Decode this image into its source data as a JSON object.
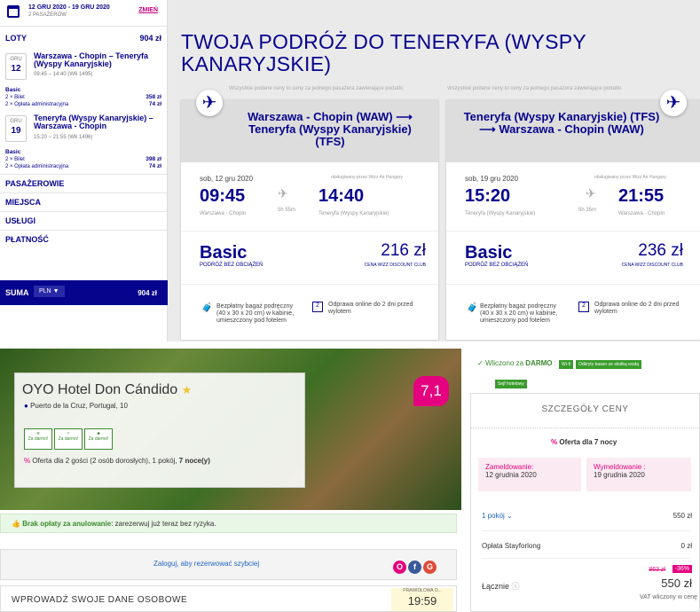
{
  "sidebar": {
    "dates": "12 GRU 2020 - 19 GRU 2020",
    "pax": "2 PASAŻERÓW",
    "change": "ZMIEŃ",
    "flights_label": "LOTY",
    "flights_total": "904 zł",
    "f1": {
      "month": "GRU",
      "day": "12",
      "route": "Warszawa - Chopin – Teneryfa (Wyspy Kanaryjskie)",
      "time": "09:45 – 14:40 (W6 1495)",
      "fare": "Basic",
      "l1": "2 × Bilet",
      "v1": "358 zł",
      "l2": "2 × Opłata administracyjna",
      "v2": "74 zł"
    },
    "f2": {
      "month": "GRU",
      "day": "19",
      "route": "Teneryfa (Wyspy Kanaryjskie) – Warszawa - Chopin",
      "time": "15:20 – 21:55 (W6 1496)",
      "fare": "Basic",
      "l1": "2 × Bilet",
      "v1": "398 zł",
      "l2": "2 × Opłata administracyjna",
      "v2": "74 zł"
    },
    "acc": [
      "PASAŻEROWIE",
      "MIEJSCA",
      "USŁUGI",
      "PŁATNOŚĆ"
    ],
    "suma": "SUMA",
    "currency": "PLN",
    "total": "904 zł"
  },
  "main": {
    "title": "TWOJA PODRÓŻ DO TENERYFA (WYSPY KANARYJSKIE)",
    "note": "Wszystkie podane ceny to ceny za jednego pasażera zawierające podatki.",
    "cards": [
      {
        "route": "Warszawa - Chopin (WAW) ⟶ Teneryfa (Wyspy Kanaryjskie) (TFS)",
        "date": "sob, 12 gru 2020",
        "op": "obsługiwany przez Wizz Air Hungary",
        "dep": "09:45",
        "arr": "14:40",
        "dur": "5h 55m",
        "from": "Warszawa - Chopin",
        "to": "Teneryfa (Wyspy Kanaryjskie)",
        "fare": "Basic",
        "fare_sub": "PODRÓŻ BEZ OBCIĄŻEŃ",
        "price": "216 zł",
        "club": "CENA WIZZ DISCOUNT CLUB",
        "bag": "Bezpłatny bagaż podręczny (40 x 30 x 20 cm) w kabinie, umieszczony pod fotelem",
        "checkin": "Odprawa online do 2 dni przed wylotem"
      },
      {
        "route": "Teneryfa (Wyspy Kanaryjskie) (TFS) ⟶ Warszawa - Chopin (WAW)",
        "date": "sob, 19 gru 2020",
        "op": "obsługiwany przez Wizz Air Hungary",
        "dep": "15:20",
        "arr": "21:55",
        "dur": "5h 35m",
        "from": "Teneryfa (Wyspy Kanaryjskie)",
        "to": "Warszawa - Chopin",
        "fare": "Basic",
        "fare_sub": "PODRÓŻ BEZ OBCIĄŻEŃ",
        "price": "236 zł",
        "club": "CENA WIZZ DISCOUNT CLUB",
        "bag": "Bezpłatny bagaż podręczny (40 x 30 x 20 cm) w kabinie, umieszczony pod fotelem",
        "checkin": "Odprawa online do 2 dni przed wylotem"
      }
    ]
  },
  "hotel": {
    "name": "OYO Hotel Don Cándido",
    "star": "★",
    "address": "Puerto de la Cruz, Portugal, 10",
    "rating": "7,1",
    "amen_label": "Za darmo!",
    "offer_pre": "Oferta dla 2 gości (2 osób dorosłych), 1 pokój, ",
    "offer_bold": "7 noce(y)",
    "free_cancel_bold": "Brak opłaty za anulowanie",
    "free_cancel": ": zarezerwuj już teraz bez ryzyka.",
    "login": "Zaloguj, aby rezerwować szybciej",
    "personal": "WPROWADŹ SWOJE DANE OSOBOWE",
    "timer_label": "PRAWIDŁOWA O...",
    "timer": "19:59"
  },
  "price": {
    "included_pre": "Wliczono za ",
    "included_bold": "DARMO",
    "included_post": " :",
    "tags": [
      "Wi-fi",
      "Odkryty basen ze słodką wodą",
      "Sejf hotelowy"
    ],
    "header": "SZCZEGÓŁY CENY",
    "offer": "Oferta dla 7 nocy",
    "checkin_label": "Zameldowanie:",
    "checkin": "12 grudnia 2020",
    "checkout_label": "Wymeldowanie :",
    "checkout": "19 grudnia 2020",
    "rooms": "1 pokój",
    "rooms_price": "550 zł",
    "fee_label": "Opłata Stayforlong",
    "fee": "0 zł",
    "old": "863 zł",
    "discount": "-36%",
    "total_label": "Łącznie",
    "total": "550 zł",
    "vat": "VAT wliczony w cenę"
  }
}
